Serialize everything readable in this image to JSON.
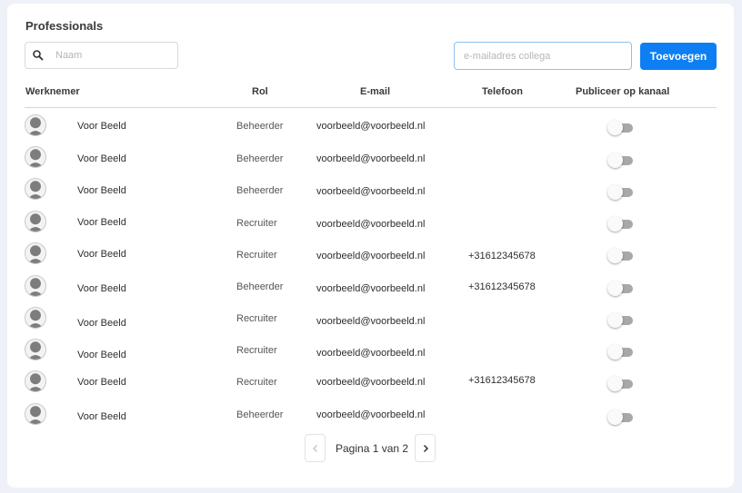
{
  "header": {
    "title": "Professionals"
  },
  "search": {
    "placeholder": "Naam",
    "icon": "search-icon"
  },
  "invite": {
    "placeholder": "e-mailadres collega",
    "button_label": "Toevoegen",
    "accent": "#0d7ff3"
  },
  "table": {
    "columns": [
      "Werknemer",
      "Rol",
      "E-mail",
      "Telefoon",
      "Publiceer op kanaal"
    ],
    "rows": [
      {
        "name": "Voor Beeld",
        "role": "Beheerder",
        "email": "voorbeeld@voorbeeld.nl",
        "phone": "",
        "publish": false
      },
      {
        "name": "Voor Beeld",
        "role": "Beheerder",
        "email": "voorbeeld@voorbeeld.nl",
        "phone": "",
        "publish": false
      },
      {
        "name": "Voor Beeld",
        "role": "Beheerder",
        "email": "voorbeeld@voorbeeld.nl",
        "phone": "",
        "publish": false
      },
      {
        "name": "Voor Beeld",
        "role": "Recruiter",
        "email": "voorbeeld@voorbeeld.nl",
        "phone": "",
        "publish": false
      },
      {
        "name": "Voor Beeld",
        "role": "Recruiter",
        "email": "voorbeeld@voorbeeld.nl",
        "phone": "+31612345678",
        "publish": false
      },
      {
        "name": "Voor Beeld",
        "role": "Beheerder",
        "email": "voorbeeld@voorbeeld.nl",
        "phone": "+31612345678",
        "publish": false
      },
      {
        "name": "Voor Beeld",
        "role": "Recruiter",
        "email": "voorbeeld@voorbeeld.nl",
        "phone": "",
        "publish": false
      },
      {
        "name": "Voor Beeld",
        "role": "Recruiter",
        "email": "voorbeeld@voorbeeld.nl",
        "phone": "",
        "publish": false
      },
      {
        "name": "Voor Beeld",
        "role": "Recruiter",
        "email": "voorbeeld@voorbeeld.nl",
        "phone": "+31612345678",
        "publish": false
      },
      {
        "name": "Voor Beeld",
        "role": "Beheerder",
        "email": "voorbeeld@voorbeeld.nl",
        "phone": "",
        "publish": false
      }
    ]
  },
  "pagination": {
    "label": "Pagina 1 van 2",
    "prev_icon": "chevron-left-icon",
    "next_icon": "chevron-right-icon"
  }
}
